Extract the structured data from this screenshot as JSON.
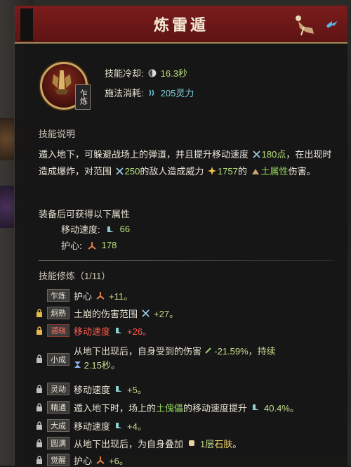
{
  "window": {
    "title": "炼雷遁"
  },
  "skill": {
    "badge": "乍炼",
    "cooldown_label": "技能冷却:",
    "cooldown_value": "16.3秒",
    "cost_label": "施法消耗:",
    "cost_value": "205灵力"
  },
  "description": {
    "section_title": "技能说明",
    "part1": "遁入地下，可躲避战场上的弹道，并且提升移动速度",
    "value1": "180点",
    "part2": "，在出现时造成爆炸，对范围",
    "value2": "250",
    "part3": "的敌人造成威力",
    "value3": "1757",
    "part4": "的",
    "element": "土属性",
    "part5": "伤害。"
  },
  "equip": {
    "title": "装备后可获得以下属性",
    "attrs": [
      {
        "label": "移动速度:",
        "value": "66"
      },
      {
        "label": "护心:",
        "value": "178"
      }
    ]
  },
  "training": {
    "title": "技能修炼（1/11）",
    "rows": [
      {
        "tag": "乍炼",
        "text": "护心",
        "value": "+11。"
      },
      {
        "tag": "炯熟",
        "text": "土崩的伤害范围",
        "value": "+27。"
      },
      {
        "tag": "通晓",
        "text": "移动速度",
        "value": "+26。"
      },
      {
        "tag": "小成",
        "line1a": "从地下出现后，自身受到的伤害",
        "line1b": "-21.59%，持续",
        "line2": "2.15秒。"
      },
      {
        "tag": "灵动",
        "text": "移动速度",
        "value": "+5。"
      },
      {
        "tag": "精通",
        "text_a": "遁入地下时，场上的",
        "highlight": "土傀儡",
        "text_b": "的移动速度提升",
        "value": "40.4%。"
      },
      {
        "tag": "大成",
        "text": "移动速度",
        "value": "+4。"
      },
      {
        "tag": "圆满",
        "text_a": "从地下出现后，为自身叠加",
        "count": "1层",
        "highlight": "石肤",
        "end": "。"
      },
      {
        "tag": "觉醒",
        "text": "护心",
        "value": "+6。"
      }
    ]
  },
  "colors": {
    "title_bar": "#6e1818",
    "accent_gold": "#c9a560",
    "value_green": "#b8e07a",
    "warn_red": "#ff5a4a"
  },
  "icons": [
    "cooldown-icon",
    "mana-icon",
    "range-icon",
    "power-icon",
    "earth-element-icon",
    "speed-icon",
    "heart-guard-icon",
    "lock-icon",
    "clock-icon",
    "shield-icon",
    "stone-skin-icon"
  ]
}
